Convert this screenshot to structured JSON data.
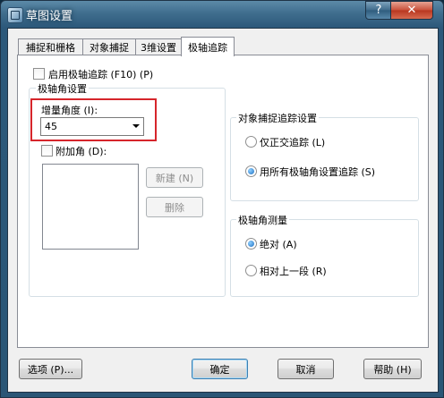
{
  "window": {
    "title": "草图设置",
    "help_label": "?",
    "close_label": "✕"
  },
  "tabs": [
    {
      "label": "捕捉和栅格"
    },
    {
      "label": "对象捕捉"
    },
    {
      "label": "3维设置"
    },
    {
      "label": "极轴追踪",
      "active": true
    }
  ],
  "polar": {
    "enable_label": "启用极轴追踪 (F10) (P)",
    "angle_group_title": "极轴角设置",
    "increment_label": "增量角度 (I):",
    "increment_value": "45",
    "additional_label": "附加角 (D):",
    "new_button": "新建 (N)",
    "delete_button": "删除"
  },
  "snap_tracking": {
    "title": "对象捕捉追踪设置",
    "options": [
      {
        "label": "仅正交追踪 (L)",
        "selected": false
      },
      {
        "label": "用所有极轴角设置追踪 (S)",
        "selected": true
      }
    ]
  },
  "measurement": {
    "title": "极轴角测量",
    "options": [
      {
        "label": "绝对 (A)",
        "selected": true
      },
      {
        "label": "相对上一段 (R)",
        "selected": false
      }
    ]
  },
  "footer": {
    "options_button": "选项 (P)...",
    "ok_button": "确定",
    "cancel_button": "取消",
    "help_button": "帮助 (H)"
  },
  "colors": {
    "highlight_box": "#d6252b",
    "title_bar": "#2c587a"
  }
}
